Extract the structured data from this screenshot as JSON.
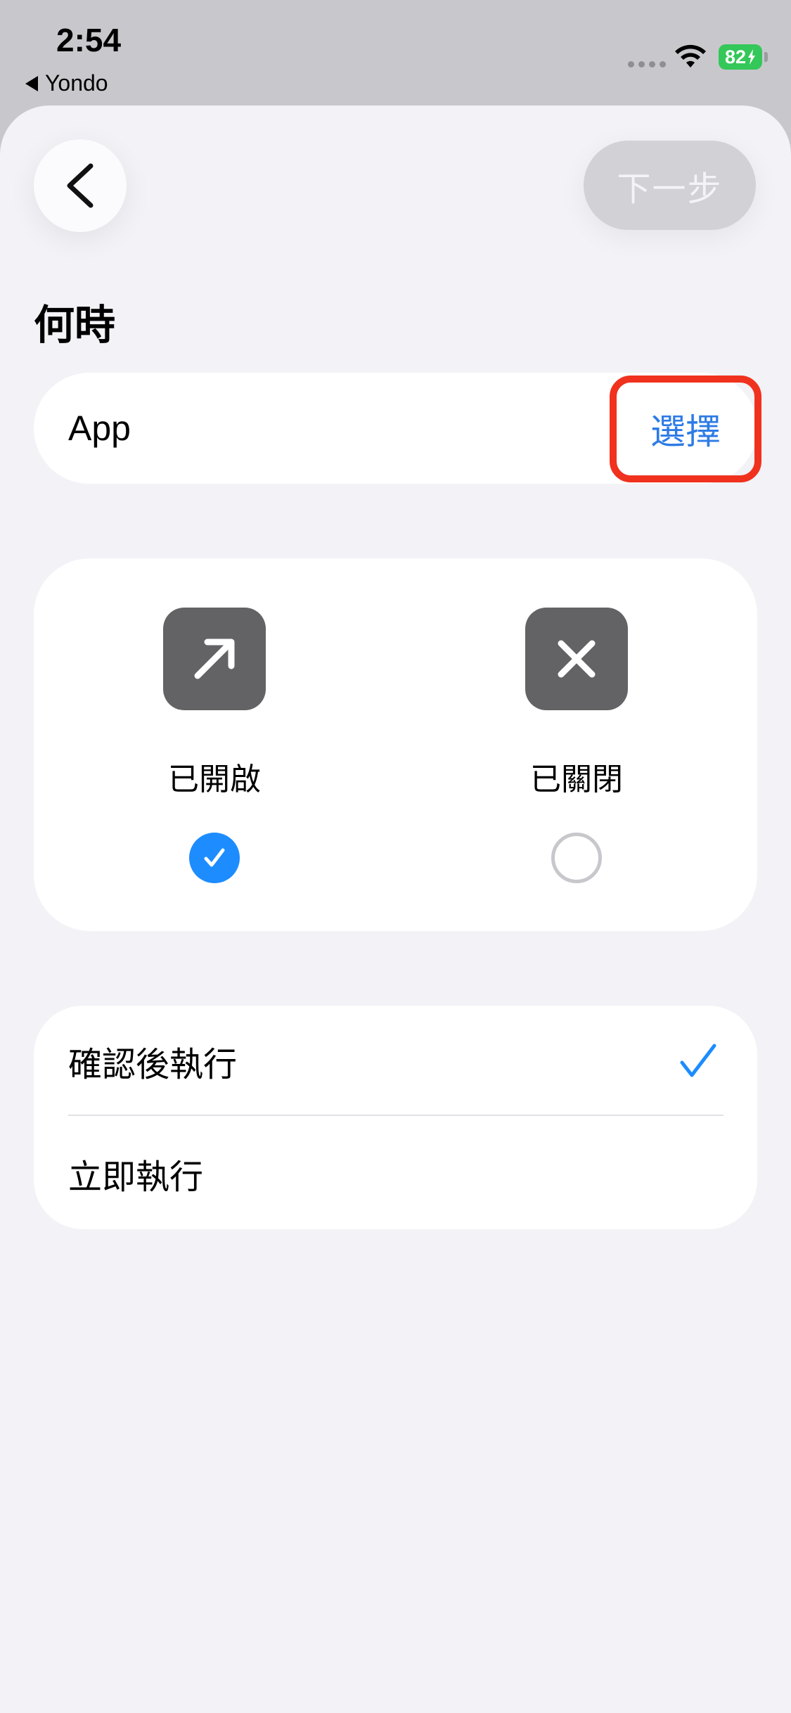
{
  "status_bar": {
    "time": "2:54",
    "back_app": "Yondo",
    "battery": "82"
  },
  "header": {
    "next_label": "下一步",
    "back_icon": "chevron-left-icon"
  },
  "section": {
    "title": "何時"
  },
  "app_row": {
    "label": "App",
    "choose_label": "選擇"
  },
  "app_state": {
    "opened": {
      "label": "已開啟",
      "icon": "arrow-up-right-icon",
      "selected": true
    },
    "closed": {
      "label": "已關閉",
      "icon": "xmark-icon",
      "selected": false
    }
  },
  "run_mode": {
    "items": [
      {
        "label": "確認後執行",
        "selected": true
      },
      {
        "label": "立即執行",
        "selected": false
      }
    ]
  },
  "colors": {
    "accent": "#1c8cff",
    "highlight": "#f0311d",
    "battery": "#34c759"
  }
}
